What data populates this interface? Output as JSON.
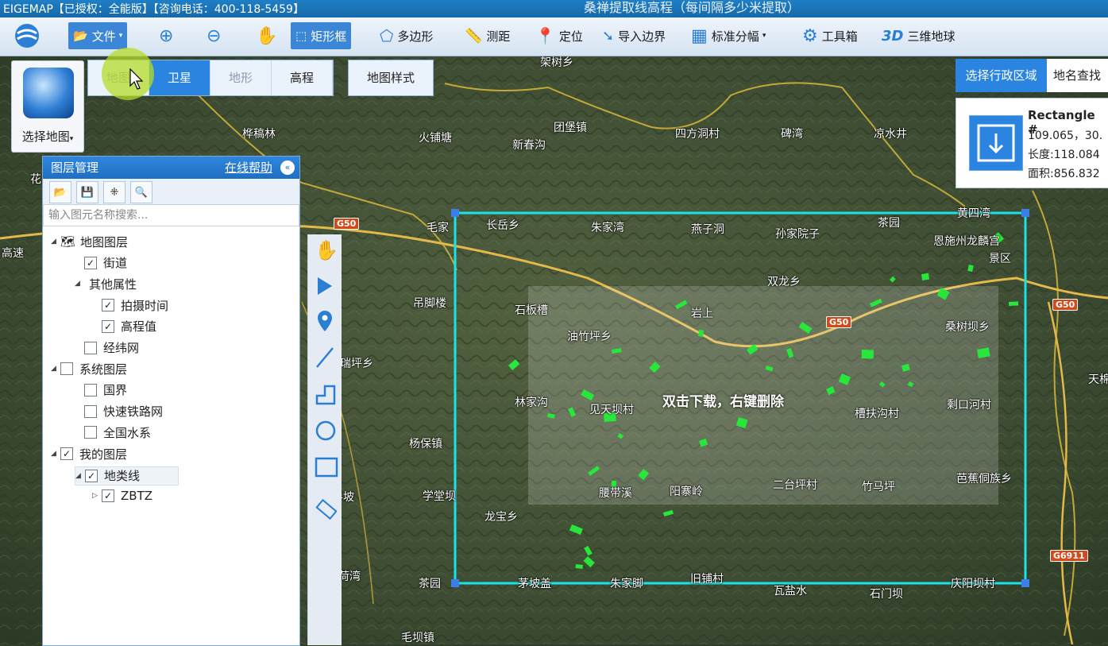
{
  "window": {
    "app_title": "EIGEMAP【已授权：全能版】【咨询电话：400-118-5459】",
    "video_title": "桑禅提取线高程（每间隔多少米提取）"
  },
  "toolbar": {
    "file": "文件",
    "rect": "矩形框",
    "polygon": "多边形",
    "measure": "测距",
    "locate": "定位",
    "import_boundary": "导入边界",
    "grid": "标准分幅",
    "toolbox": "工具箱",
    "threed_badge": "3D",
    "threed": "三维地球"
  },
  "maptype": {
    "tabs": [
      "地图",
      "卫星",
      "地形",
      "高程"
    ],
    "selected": "卫星",
    "style_button": "地图样式"
  },
  "choose_map": {
    "label": "选择地图"
  },
  "layer_panel": {
    "title": "图层管理",
    "help": "在线帮助",
    "search_placeholder": "输入图元名称搜索...",
    "tree": [
      {
        "label": "地图图层",
        "checked": null
      },
      {
        "label": "街道",
        "checked": true
      },
      {
        "label": "其他属性",
        "checked": null
      },
      {
        "label": "拍摄时间",
        "checked": true
      },
      {
        "label": "高程值",
        "checked": true
      },
      {
        "label": "经纬网",
        "checked": false
      },
      {
        "label": "系统图层",
        "checked": false
      },
      {
        "label": "国界",
        "checked": false
      },
      {
        "label": "快速铁路网",
        "checked": false
      },
      {
        "label": "全国水系",
        "checked": false
      },
      {
        "label": "我的图层",
        "checked": true
      },
      {
        "label": "地类线",
        "checked": true
      },
      {
        "label": "ZBTZ",
        "checked": true
      }
    ]
  },
  "right_panel": {
    "select_region": "选择行政区域",
    "place_search": "地名查找",
    "rect_title": "Rectangle #",
    "coords": "109.065，30.",
    "length": "长度:118.084",
    "area": "面积:856.832"
  },
  "map": {
    "hint": "双击下载，右键删除",
    "road_badges": [
      "G50",
      "G50",
      "G50",
      "G6911"
    ],
    "places": [
      "架树乡",
      "桦稿林",
      "火铺塘",
      "团堡镇",
      "新春沟",
      "四方洞村",
      "碑湾",
      "凉水井",
      "毛家",
      "长岳乡",
      "朱家湾",
      "燕子洞",
      "孙家院子",
      "茶园",
      "黄四湾",
      "恩施州龙麟宫",
      "景区",
      "双龙乡",
      "吊脚楼",
      "石板槽",
      "岩上",
      "桑树坝乡",
      "油竹坪乡",
      "瑞坪乡",
      "林家沟",
      "见天坝村",
      "槽扶沟村",
      "剩口河村",
      "杨保镇",
      "学堂坝",
      "腰带溪",
      "阳寨岭",
      "二台坪村",
      "竹马坪",
      "芭蕉侗族乡",
      "半坡",
      "龙宝乡",
      "洋荷湾",
      "茶园",
      "茅坡盖",
      "朱家脚",
      "旧铺村",
      "瓦盐水",
      "石门坝",
      "庆阳坝村",
      "毛坝镇",
      "高速",
      "天棉",
      "花"
    ]
  },
  "colors": {
    "accent": "#2a84e0",
    "selection": "#19e3e8",
    "feature": "#27e83a"
  }
}
